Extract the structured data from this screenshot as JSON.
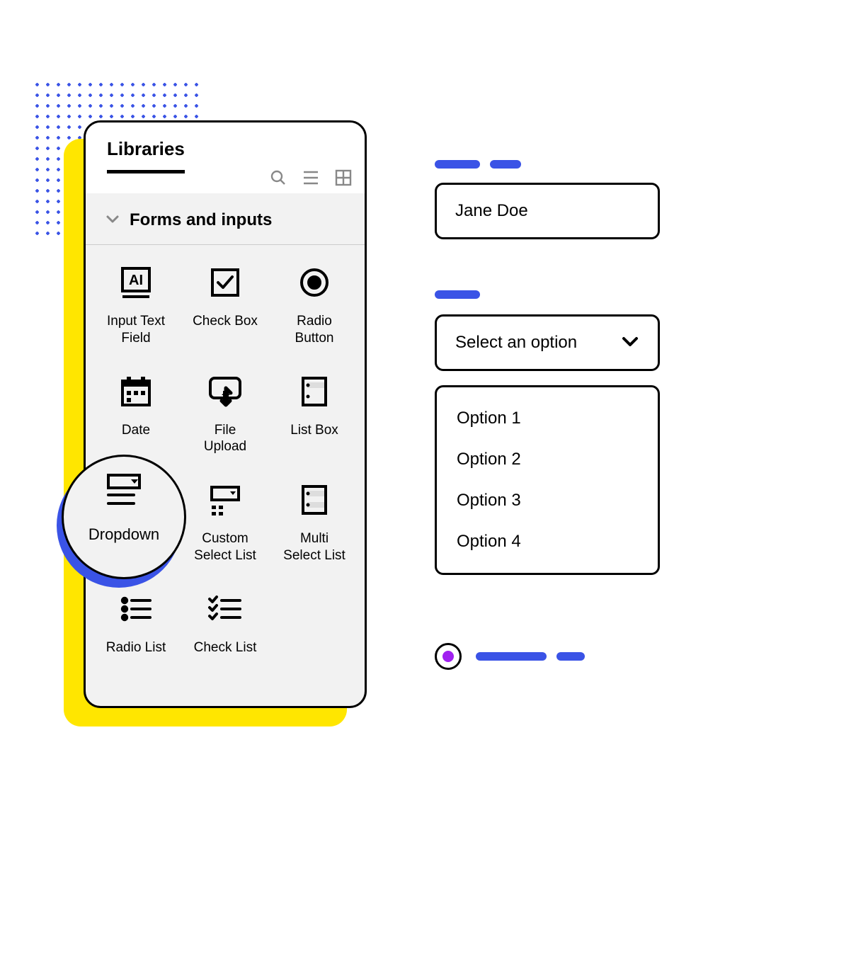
{
  "panel": {
    "title": "Libraries",
    "section_title": "Forms and inputs",
    "items": [
      {
        "label": "Input Text\nField"
      },
      {
        "label": "Check Box"
      },
      {
        "label": "Radio\nButton"
      },
      {
        "label": "Date"
      },
      {
        "label": "File\nUpload"
      },
      {
        "label": "List Box"
      },
      {
        "label": "Dropdown"
      },
      {
        "label": "Custom\nSelect List"
      },
      {
        "label": "Multi\nSelect List"
      },
      {
        "label": "Radio List"
      },
      {
        "label": "Check List"
      }
    ],
    "highlighted_index": 6
  },
  "preview": {
    "text_input_value": "Jane Doe",
    "select_placeholder": "Select an option",
    "options": [
      "Option 1",
      "Option 2",
      "Option 3",
      "Option 4"
    ]
  }
}
